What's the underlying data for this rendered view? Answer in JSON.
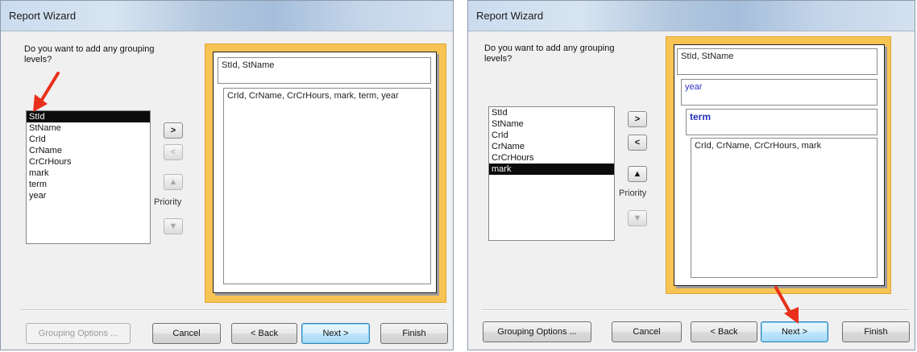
{
  "colors": {
    "annotation_arrow": "#e8301a",
    "preview_frame": "#f7c454",
    "selection": "#0b0b0b",
    "group_text_blue": "#2c32c4"
  },
  "left": {
    "title": "Report Wizard",
    "question": "Do you want to add any grouping levels?",
    "fields": [
      "StId",
      "StName",
      "CrId",
      "CrName",
      "CrCrHours",
      "mark",
      "term",
      "year"
    ],
    "selected_field": "StId",
    "buttons": {
      "add": ">",
      "remove": "<",
      "up_icon": "up-arrow-icon",
      "priority_label": "Priority",
      "down_icon": "down-arrow-icon"
    },
    "preview": {
      "group1": "StId, StName",
      "detail": "CrId, CrName, CrCrHours, mark, term, year"
    },
    "footer": {
      "grouping_options": "Grouping Options ...",
      "cancel": "Cancel",
      "back": "< Back",
      "next": "Next >",
      "finish": "Finish"
    }
  },
  "right": {
    "title": "Report Wizard",
    "question": "Do you want to add any grouping levels?",
    "fields": [
      "StId",
      "StName",
      "CrId",
      "CrName",
      "CrCrHours",
      "mark"
    ],
    "selected_field": "mark",
    "buttons": {
      "add": ">",
      "remove": "<",
      "up_icon": "up-arrow-icon",
      "priority_label": "Priority",
      "down_icon": "down-arrow-icon"
    },
    "preview": {
      "group1": "StId, StName",
      "group2": "year",
      "group3": "term",
      "detail": "CrId, CrName, CrCrHours, mark"
    },
    "footer": {
      "grouping_options": "Grouping Options ...",
      "cancel": "Cancel",
      "back": "< Back",
      "next": "Next >",
      "finish": "Finish"
    }
  }
}
